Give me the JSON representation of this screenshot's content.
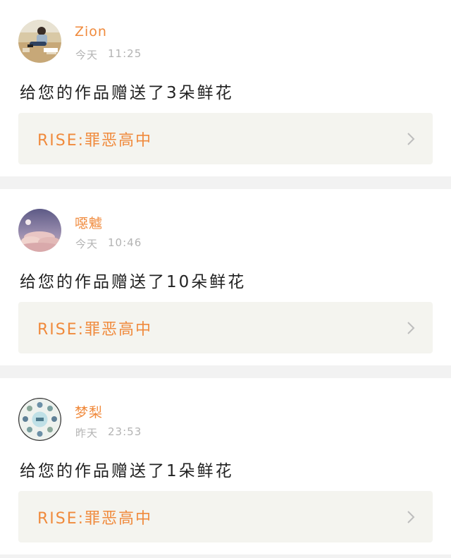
{
  "feed": [
    {
      "username": "Zion",
      "day": "今天",
      "time": "11:25",
      "message": "给您的作品赠送了3朵鲜花",
      "work_title": "RISE:罪恶高中",
      "avatar_icon": "photo-avatar-person-icon"
    },
    {
      "username": "噁魖",
      "day": "今天",
      "time": "10:46",
      "message": "给您的作品赠送了10朵鲜花",
      "work_title": "RISE:罪恶高中",
      "avatar_icon": "photo-avatar-sky-icon"
    },
    {
      "username": "梦梨",
      "day": "昨天",
      "time": "23:53",
      "message": "给您的作品赠送了1朵鲜花",
      "work_title": "RISE:罪恶高中",
      "avatar_icon": "photo-avatar-group-icon"
    }
  ],
  "colors": {
    "accent": "#f08a3c",
    "meta_text": "#b3b3b3",
    "link_bg": "#f4f4ef",
    "divider": "#f2f2f2"
  }
}
